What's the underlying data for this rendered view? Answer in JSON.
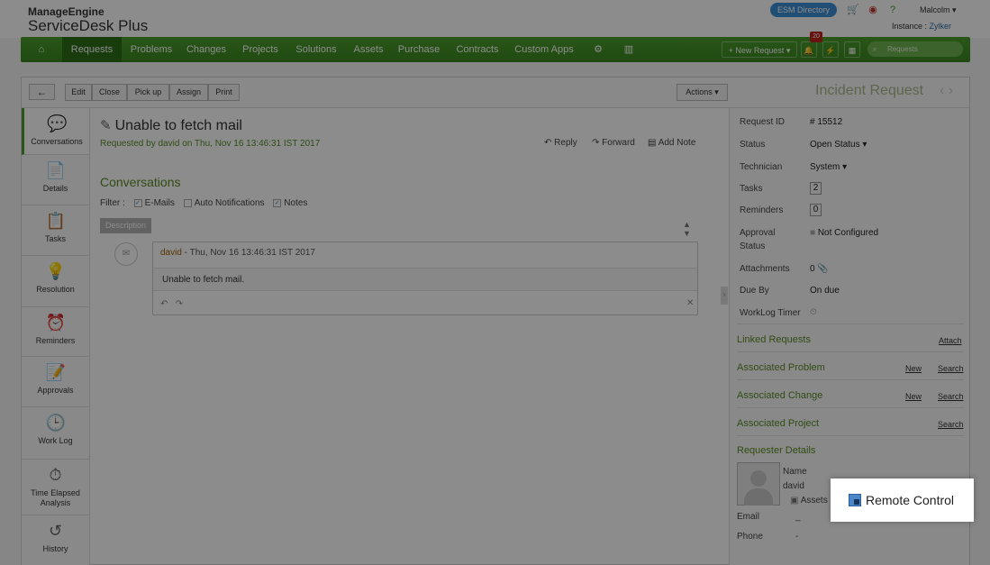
{
  "header": {
    "brand_top": "ManageEngine",
    "brand_product": "ServiceDesk Plus",
    "esm_directory": "ESM Directory",
    "user": "Malcolm",
    "instance_label": "Instance :",
    "instance_name": "Zylker"
  },
  "nav": {
    "tabs": [
      "Requests",
      "Problems",
      "Changes",
      "Projects",
      "Solutions",
      "Assets",
      "Purchase",
      "Contracts",
      "Custom Apps"
    ],
    "new_request": "+ New Request",
    "notification_count": "20",
    "search_placeholder": "Requests"
  },
  "toolbar": {
    "buttons": [
      "Edit",
      "Close",
      "Pick up",
      "Assign",
      "Print"
    ],
    "actions": "Actions",
    "page_title": "Incident Request"
  },
  "sidebar": {
    "items": [
      {
        "label": "Conversations"
      },
      {
        "label": "Details"
      },
      {
        "label": "Tasks"
      },
      {
        "label": "Resolution"
      },
      {
        "label": "Reminders"
      },
      {
        "label": "Approvals"
      },
      {
        "label": "Work Log"
      },
      {
        "label": "Time Elapsed Analysis"
      },
      {
        "label": "History"
      }
    ]
  },
  "request": {
    "subject": "Unable to fetch mail",
    "requested_by_prefix": "Requested by",
    "requester": "david",
    "on": "on",
    "date": "Thu, Nov 16 13:46:31 IST 2017",
    "reply": "Reply",
    "forward": "Forward",
    "add_note": "Add Note"
  },
  "conversations": {
    "title": "Conversations",
    "filter_label": "Filter :",
    "filters": [
      "E-Mails",
      "Auto Notifications",
      "Notes"
    ],
    "description_label": "Description",
    "message": {
      "author": "david",
      "meta": " - Thu, Nov 16 13:46:31 IST 2017",
      "body": "Unable to fetch mail."
    }
  },
  "properties": {
    "request_id_label": "Request ID",
    "request_id": "# 15512",
    "status_label": "Status",
    "status": "Open Status",
    "technician_label": "Technician",
    "technician": "System",
    "tasks_label": "Tasks",
    "tasks_count": "2",
    "reminders_label": "Reminders",
    "reminders_count": "0",
    "approval_label_1": "Approval",
    "approval_label_2": "Status",
    "approval": "Not Configured",
    "attachments_label": "Attachments",
    "attachments": "0",
    "due_by_label": "Due By",
    "due_by": "On due",
    "worklog_label": "WorkLog Timer"
  },
  "sections": {
    "linked": "Linked Requests",
    "attach": "Attach",
    "problem": "Associated Problem",
    "change": "Associated Change",
    "project": "Associated Project",
    "new": "New",
    "search": "Search",
    "requester": "Requester Details"
  },
  "requester": {
    "name_label": "Name",
    "name": "david",
    "assets": "Assets",
    "email_label": "Email",
    "email": "_",
    "phone_label": "Phone",
    "phone": "-"
  },
  "popup": {
    "remote_control": "Remote Control"
  }
}
